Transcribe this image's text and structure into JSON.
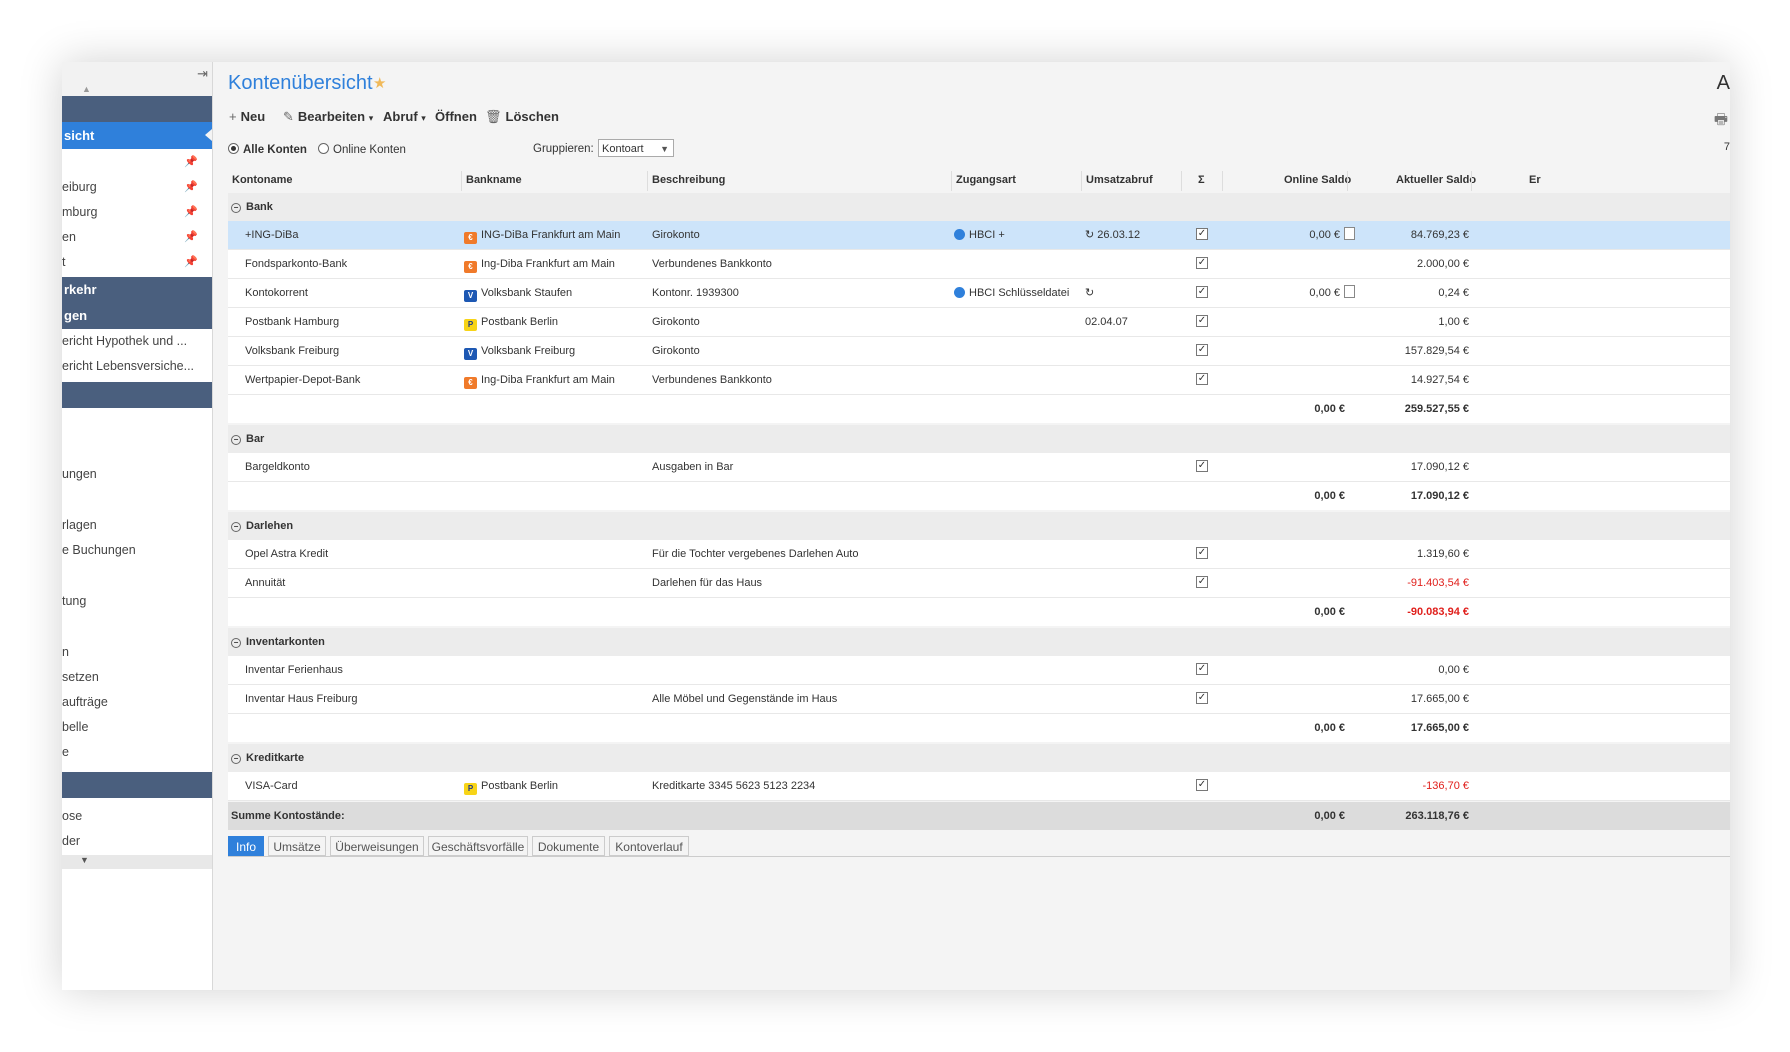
{
  "sidebar": {
    "selected": "sicht",
    "items": [
      {
        "label": "",
        "pinned": true
      },
      {
        "label": "eiburg",
        "pinned": true
      },
      {
        "label": "mburg",
        "pinned": true
      },
      {
        "label": "en",
        "pinned": true
      },
      {
        "label": "t",
        "pinned": true
      }
    ],
    "header2": "rkehr",
    "header3": "gen",
    "links": [
      "ericht Hypothek und ...",
      "ericht Lebensversiche..."
    ],
    "lower": [
      "ungen",
      "rlagen",
      "e Buchungen",
      "tung",
      "n",
      "setzen",
      "aufträge",
      "belle",
      "e"
    ],
    "bottom": [
      "ose",
      "der"
    ]
  },
  "main": {
    "title": "Kontenübersicht",
    "title_cut": "A",
    "toolbar": {
      "new": "Neu",
      "edit": "Bearbeiten",
      "fetch": "Abruf",
      "open": "Öffnen",
      "delete": "Löschen"
    },
    "filter": {
      "all": "Alle Konten",
      "online": "Online Konten",
      "group_label": "Gruppieren:",
      "group_value": "Kontoart",
      "cut": "7"
    },
    "columns": {
      "kontoname": "Kontoname",
      "bankname": "Bankname",
      "beschreibung": "Beschreibung",
      "zugangsart": "Zugangsart",
      "umsatzabruf": "Umsatzabruf",
      "sigma": "Σ",
      "online_saldo": "Online Saldo",
      "aktueller_saldo": "Aktueller Saldo",
      "cut": "Er"
    },
    "groups": [
      {
        "name": "Bank"
      },
      {
        "name": "Bar"
      },
      {
        "name": "Darlehen"
      },
      {
        "name": "Inventarkonten"
      },
      {
        "name": "Kreditkarte"
      }
    ],
    "rows": [
      {
        "konto": "+ING-DiBa",
        "bank": "ING-DiBa Frankfurt am Main",
        "beschreibung": "Girokonto",
        "zugang": "HBCI +",
        "abruf": "26.03.12",
        "online": "0,00 €",
        "aktuell": "84.769,23 €"
      },
      {
        "konto": "Fondsparkonto-Bank",
        "bank": "Ing-Diba Frankfurt am Main",
        "beschreibung": "Verbundenes Bankkonto",
        "zugang": "",
        "abruf": "",
        "online": "",
        "aktuell": "2.000,00 €"
      },
      {
        "konto": "Kontokorrent",
        "bank": "Volksbank Staufen",
        "beschreibung": "Kontonr. 1939300",
        "zugang": "HBCI Schlüsseldatei",
        "abruf": "",
        "online": "0,00 €",
        "aktuell": "0,24 €"
      },
      {
        "konto": "Postbank Hamburg",
        "bank": "Postbank Berlin",
        "beschreibung": "Girokonto",
        "zugang": "",
        "abruf": "02.04.07",
        "online": "",
        "aktuell": "1,00 €"
      },
      {
        "konto": "Volksbank Freiburg",
        "bank": "Volksbank Freiburg",
        "beschreibung": "Girokonto",
        "zugang": "",
        "abruf": "",
        "online": "",
        "aktuell": "157.829,54 €"
      },
      {
        "konto": "Wertpapier-Depot-Bank",
        "bank": "Ing-Diba Frankfurt am Main",
        "beschreibung": "Verbundenes Bankkonto",
        "zugang": "",
        "abruf": "",
        "online": "",
        "aktuell": "14.927,54 €"
      },
      {
        "konto": "Bargeldkonto",
        "bank": "",
        "beschreibung": "Ausgaben in Bar",
        "zugang": "",
        "abruf": "",
        "online": "",
        "aktuell": "17.090,12 €"
      },
      {
        "konto": "Opel Astra Kredit",
        "bank": "",
        "beschreibung": "Für die Tochter vergebenes Darlehen Auto",
        "zugang": "",
        "abruf": "",
        "online": "",
        "aktuell": "1.319,60 €"
      },
      {
        "konto": "Annuität",
        "bank": "",
        "beschreibung": "Darlehen für das Haus",
        "zugang": "",
        "abruf": "",
        "online": "",
        "aktuell": "-91.403,54 €"
      },
      {
        "konto": "Inventar Ferienhaus",
        "bank": "",
        "beschreibung": "",
        "zugang": "",
        "abruf": "",
        "online": "",
        "aktuell": "0,00 €"
      },
      {
        "konto": "Inventar Haus Freiburg",
        "bank": "",
        "beschreibung": "Alle Möbel und Gegenstände im Haus",
        "zugang": "",
        "abruf": "",
        "online": "",
        "aktuell": "17.665,00 €"
      },
      {
        "konto": "VISA-Card",
        "bank": "Postbank Berlin",
        "beschreibung": "Kreditkarte 3345 5623 5123 2234",
        "zugang": "",
        "abruf": "",
        "online": "",
        "aktuell": "-136,70 €"
      }
    ],
    "subtotals": [
      {
        "online": "0,00 €",
        "aktuell": "259.527,55 €"
      },
      {
        "online": "0,00 €",
        "aktuell": "17.090,12 €"
      },
      {
        "online": "0,00 €",
        "aktuell": "-90.083,94 €"
      },
      {
        "online": "0,00 €",
        "aktuell": "17.665,00 €"
      }
    ],
    "total": {
      "label": "Summe Kontostände:",
      "online": "0,00 €",
      "aktuell": "263.118,76 €"
    },
    "tabs": [
      "Info",
      "Umsätze",
      "Überweisungen",
      "Geschäftsvorfälle",
      "Dokumente",
      "Kontoverlauf"
    ],
    "colors": {
      "accent": "#2f80db",
      "header": "#4a5f7e",
      "highlight": "#cde4fa",
      "negative": "#e0201c"
    }
  }
}
